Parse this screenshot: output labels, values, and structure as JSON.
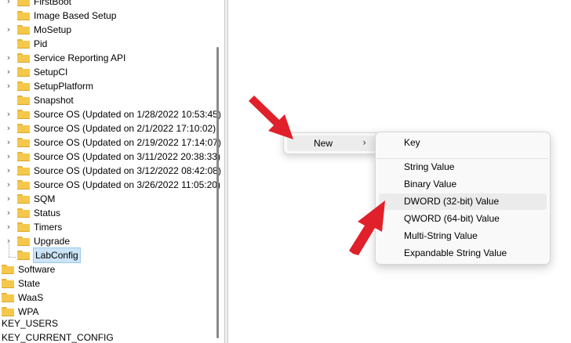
{
  "tree": {
    "items": [
      {
        "label": "FirstBoot",
        "expandable": true
      },
      {
        "label": "Image Based Setup",
        "expandable": false
      },
      {
        "label": "MoSetup",
        "expandable": true
      },
      {
        "label": "Pid",
        "expandable": false
      },
      {
        "label": "Service Reporting API",
        "expandable": true
      },
      {
        "label": "SetupCI",
        "expandable": true
      },
      {
        "label": "SetupPlatform",
        "expandable": true
      },
      {
        "label": "Snapshot",
        "expandable": false
      },
      {
        "label": "Source OS (Updated on 1/28/2022 10:53:45)",
        "expandable": true
      },
      {
        "label": "Source OS (Updated on 2/1/2022 17:10:02)",
        "expandable": true
      },
      {
        "label": "Source OS (Updated on 2/19/2022 17:14:07)",
        "expandable": true
      },
      {
        "label": "Source OS (Updated on 3/11/2022 20:38:33)",
        "expandable": true
      },
      {
        "label": "Source OS (Updated on 3/12/2022 08:42:08)",
        "expandable": true
      },
      {
        "label": "Source OS (Updated on 3/26/2022 11:05:20)",
        "expandable": true
      },
      {
        "label": "SQM",
        "expandable": true
      },
      {
        "label": "Status",
        "expandable": true
      },
      {
        "label": "Timers",
        "expandable": true
      },
      {
        "label": "Upgrade",
        "expandable": true
      },
      {
        "label": "LabConfig",
        "expandable": false,
        "selected": true
      },
      {
        "label": "Software",
        "expandable": false,
        "level": 0
      },
      {
        "label": "State",
        "expandable": false,
        "level": 0
      },
      {
        "label": "WaaS",
        "expandable": false,
        "level": 0
      },
      {
        "label": "WPA",
        "expandable": false,
        "level": 0
      }
    ],
    "hive_users": "KEY_USERS",
    "hive_config": "KEY_CURRENT_CONFIG"
  },
  "context_menu": {
    "new_label": "New",
    "new_arrow": "›"
  },
  "submenu": {
    "items": [
      "Key",
      "String Value",
      "Binary Value",
      "DWORD (32-bit) Value",
      "QWORD (64-bit) Value",
      "Multi-String Value",
      "Expandable String Value"
    ],
    "highlighted": "DWORD (32-bit) Value"
  },
  "colors": {
    "annotation_arrow": "#e0202a",
    "folder": "#f5c84c",
    "selection": "#cce4f7"
  },
  "icons": {
    "folder": "folder-icon",
    "expand": "chevron-right-icon",
    "submenu": "chevron-right-icon",
    "annotation": "red-arrow-icon"
  }
}
